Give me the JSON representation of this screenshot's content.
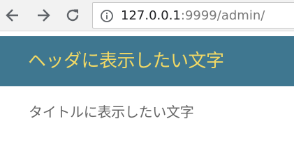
{
  "browser": {
    "url_host": "127.0.0.1",
    "url_rest": ":9999/admin/",
    "icons": {
      "back": "arrow-left-icon",
      "forward": "arrow-right-icon",
      "reload": "reload-icon",
      "site_info": "info-icon"
    }
  },
  "page": {
    "header_text": "ヘッダに表示したい文字",
    "title_text": "タイトルに表示したい文字"
  },
  "colors": {
    "header_bg": "#3f7790",
    "header_text": "#f2d965",
    "title_text": "#666666"
  }
}
